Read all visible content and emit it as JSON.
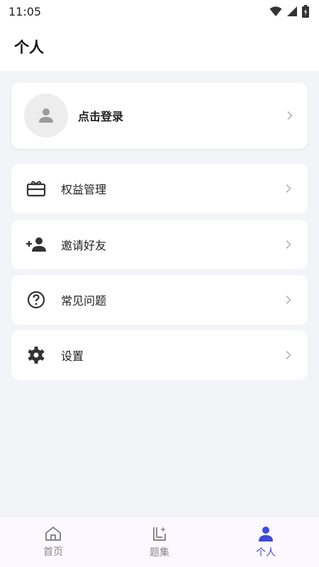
{
  "status_bar": {
    "time": "11:05",
    "icons": [
      "wifi-icon",
      "signal-icon",
      "battery-icon"
    ]
  },
  "header": {
    "title": "个人"
  },
  "profile": {
    "login_label": "点击登录",
    "avatar_icon": "person-icon"
  },
  "menu": {
    "items": [
      {
        "label": "权益管理",
        "icon": "gift-card-icon"
      },
      {
        "label": "邀请好友",
        "icon": "person-add-icon"
      },
      {
        "label": "常见问题",
        "icon": "help-circle-icon"
      },
      {
        "label": "设置",
        "icon": "gear-icon"
      }
    ]
  },
  "tabs": [
    {
      "label": "首页",
      "icon": "home-icon",
      "active": false
    },
    {
      "label": "题集",
      "icon": "question-set-icon",
      "active": false
    },
    {
      "label": "个人",
      "icon": "person-icon",
      "active": true
    }
  ],
  "colors": {
    "accent": "#3c4ae0",
    "background": "#f3f4f8",
    "card": "#ffffff",
    "icon": "#333333",
    "chevron": "#b5b5b5"
  }
}
